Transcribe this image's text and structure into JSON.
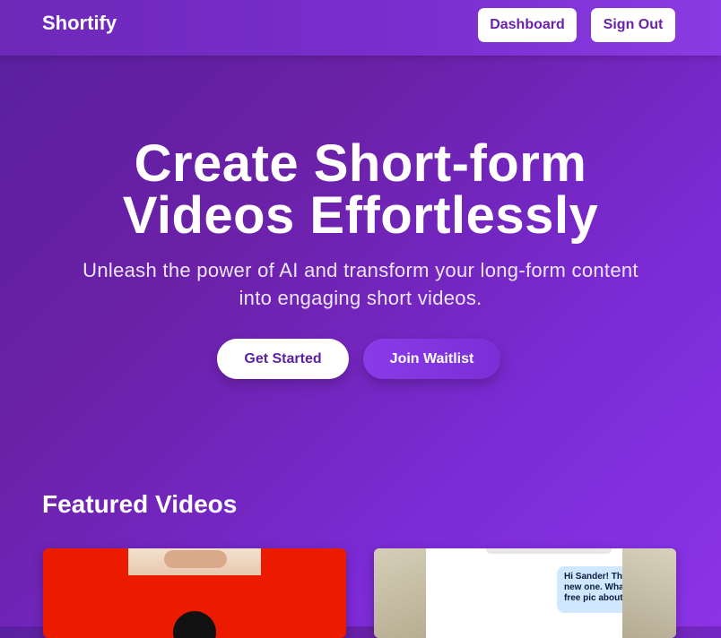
{
  "header": {
    "logo": "Shortify",
    "nav": {
      "dashboard_label": "Dashboard",
      "signout_label": "Sign Out"
    }
  },
  "hero": {
    "title_line1": "Create Short-form",
    "title_line2": "Videos Effortlessly",
    "subtitle_line1": "Unleash the power of AI and transform your long-form content",
    "subtitle_line2": "into engaging short videos.",
    "primary_cta": "Get Started",
    "secondary_cta": "Join Waitlist"
  },
  "featured": {
    "title": "Featured Videos",
    "videos": [
      {
        "thumbnail": "red-background-thumbnail"
      },
      {
        "thumbnail": "chat-screenshot-thumbnail",
        "chat_text": "Hi Sander! That's a new one. What's this free pic about?"
      }
    ]
  },
  "colors": {
    "brand_purple": "#6b21a8",
    "accent_purple": "#8a3be8",
    "thumb_red": "#ec1b00",
    "chat_bubble": "#cfe7ff"
  }
}
